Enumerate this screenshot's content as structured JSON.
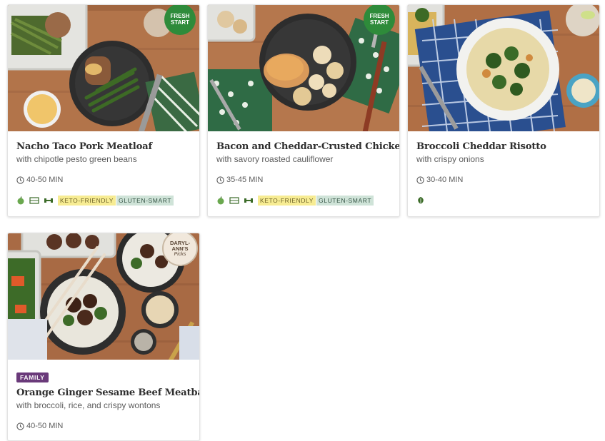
{
  "colors": {
    "card_border": "#e3e3e3",
    "title_text": "#2f2f2f",
    "meta_text": "#5c5c5c",
    "keto_tag_bg": "#f7ec93",
    "gluten_tag_bg": "#cfe3d8",
    "fresh_start_green": "#2e8b3a",
    "family_badge": "#6a3a7a"
  },
  "cards": [
    {
      "title": "Nacho Taco Pork Meatloaf",
      "subtitle": "with chipotle pesto green beans",
      "time": "40-50 MIN",
      "sticker_text": "FRESH START",
      "tag_icons": [
        "apple-icon",
        "meal-kit-icon",
        "dumbbell-icon"
      ],
      "tags": [
        "KETO-FRIENDLY",
        "GLUTEN-SMART"
      ]
    },
    {
      "title": "Bacon and Cheddar-Crusted Chicken",
      "subtitle": "with savory roasted cauliflower",
      "time": "35-45 MIN",
      "sticker_text": "FRESH START",
      "tag_icons": [
        "apple-icon",
        "meal-kit-icon",
        "dumbbell-icon"
      ],
      "tags": [
        "KETO-FRIENDLY",
        "GLUTEN-SMART"
      ]
    },
    {
      "title": "Broccoli Cheddar Risotto",
      "subtitle": "with crispy onions",
      "time": "30-40 MIN",
      "tag_icons": [
        "leaf-icon"
      ],
      "tags": []
    },
    {
      "title": "Orange Ginger Sesame Beef Meatballs",
      "subtitle": "with broccoli, rice, and crispy wontons",
      "time": "40-50 MIN",
      "badge": "FAMILY",
      "sticker_text": "DARYL-ANN'S",
      "sticker_subtext": "Picks"
    }
  ]
}
